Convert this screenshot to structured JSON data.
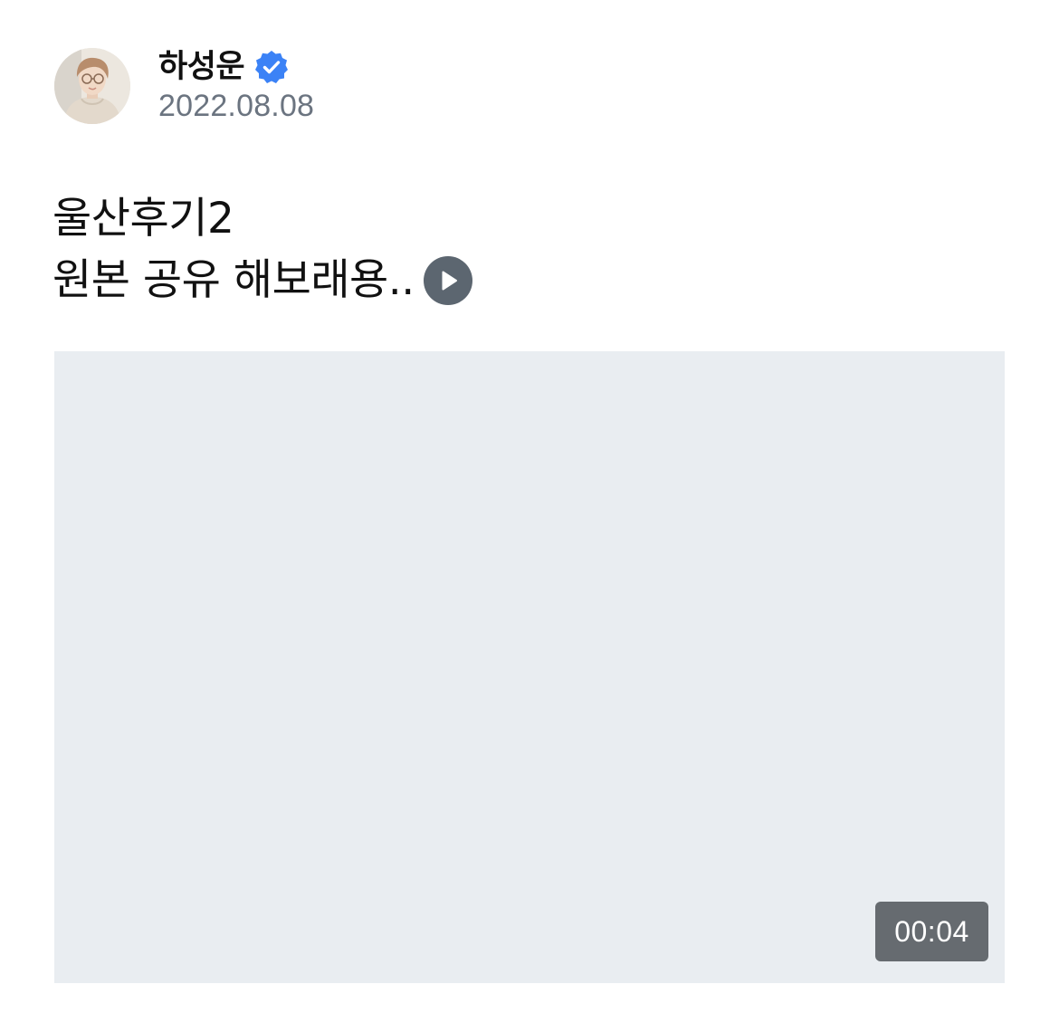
{
  "author": {
    "name": "하성운",
    "verified_icon": "verified-badge-icon",
    "avatar_icon": "profile-avatar"
  },
  "post": {
    "date": "2022.08.08",
    "text_line1": "울산후기2",
    "text_line2": "원본 공유 해보래용..",
    "inline_icon": "play-icon"
  },
  "video": {
    "duration": "00:04"
  },
  "colors": {
    "verified_blue": "#3b82f6",
    "date_gray": "#6b7480",
    "video_placeholder": "#e9edf1",
    "badge_bg": "#666b70",
    "play_icon_bg": "#5c6670"
  }
}
